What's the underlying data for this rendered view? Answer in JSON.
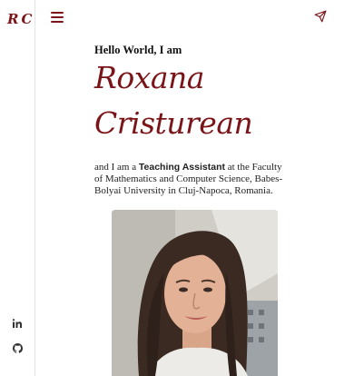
{
  "brand": {
    "logo_text": "RC"
  },
  "hero": {
    "greeting": "Hello World, I am",
    "first_name": "Roxana",
    "last_name": "Cristurean",
    "intro_prefix": "and I am a ",
    "intro_role": "Teaching Assistant",
    "intro_suffix": " at the Faculty of Mathematics and Computer Science, Babes-Bolyai University in Cluj-Napoca, Romania."
  },
  "icons": {
    "menu": "hamburger-menu-icon",
    "send": "paper-plane-icon",
    "linkedin": "linkedin-icon",
    "github": "github-icon"
  },
  "colors": {
    "accent": "#7a1419",
    "sidebar_border": "#e6e6e6"
  }
}
